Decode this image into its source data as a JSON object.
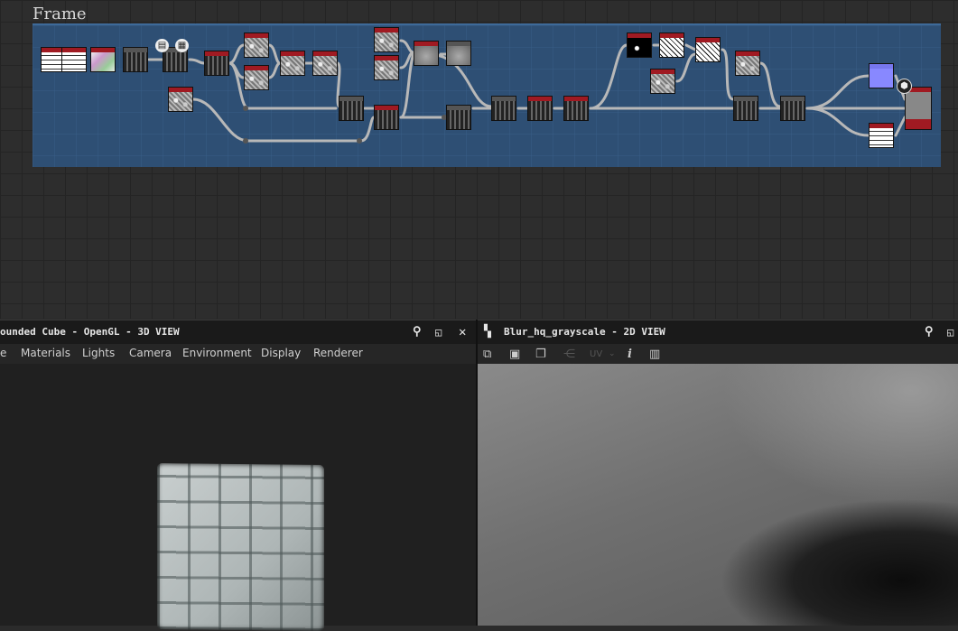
{
  "graph": {
    "frame_title": "Frame"
  },
  "panel3d": {
    "title": "ounded Cube - OpenGL - 3D VIEW",
    "menu": [
      "e",
      "Materials",
      "Lights",
      "Camera",
      "Environment",
      "Display",
      "Renderer"
    ],
    "icons": [
      "pin-icon",
      "maximize-icon",
      "close-icon"
    ]
  },
  "panel2d": {
    "title": "Blur_hq_grayscale - 2D VIEW",
    "uv_label": "UV",
    "info_glyph": "i",
    "icons": [
      "pin-icon",
      "maximize-icon"
    ]
  }
}
